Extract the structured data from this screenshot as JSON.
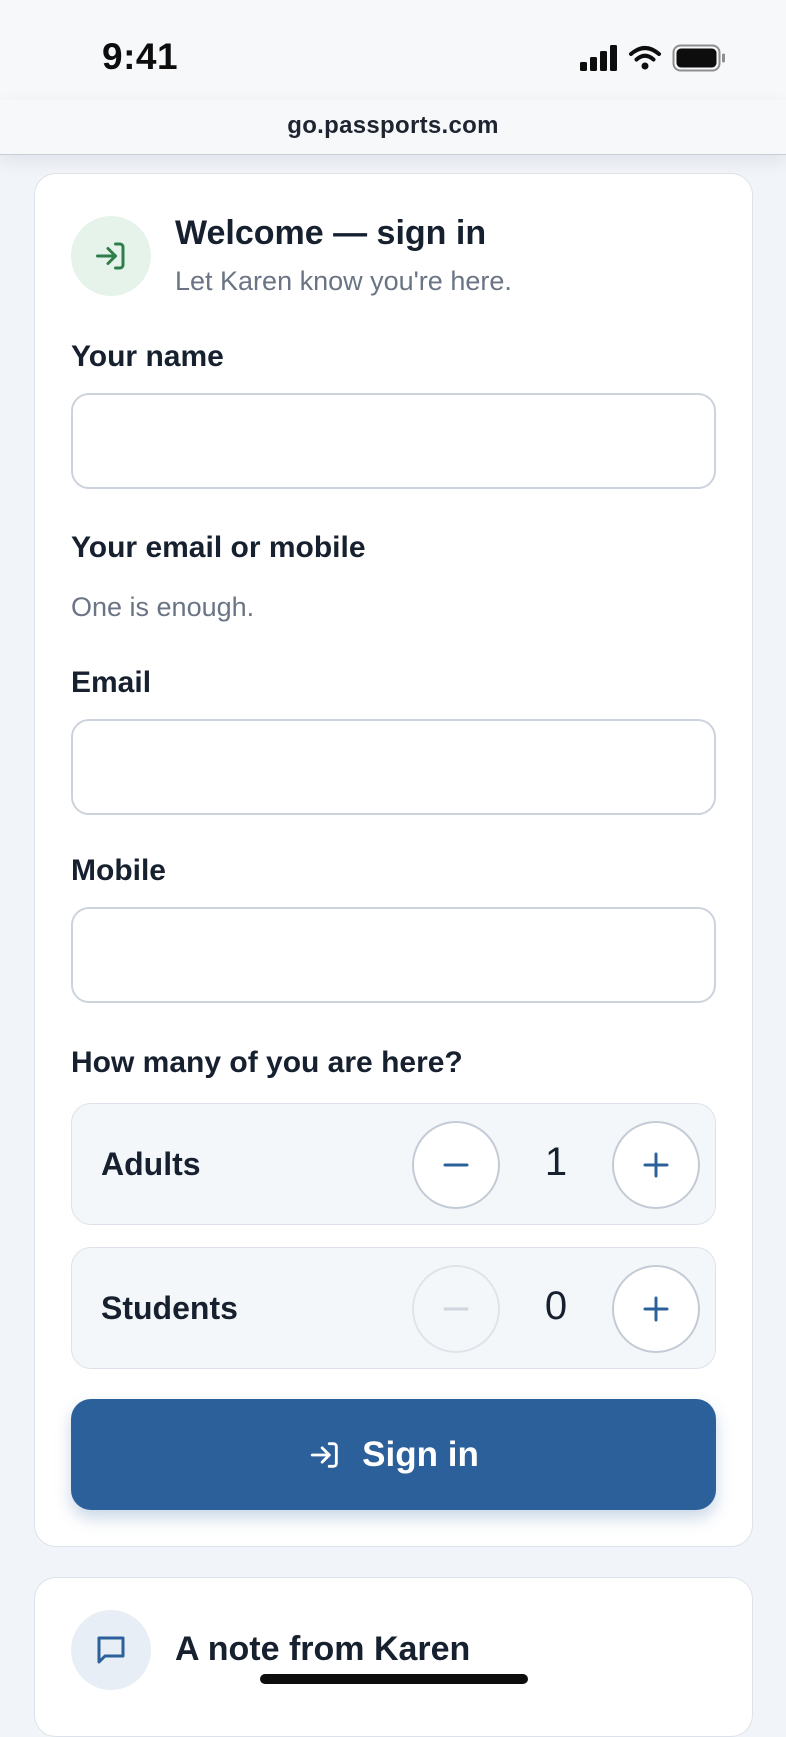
{
  "status_bar": {
    "time": "9:41"
  },
  "browser": {
    "url": "go.passports.com"
  },
  "signin_card": {
    "title": "Welcome — sign in",
    "subtitle": "Let Karen know you're here.",
    "name_label": "Your name",
    "name_value": "",
    "contact_label": "Your email or mobile",
    "contact_hint": "One is enough.",
    "email_label": "Email",
    "email_value": "",
    "mobile_label": "Mobile",
    "mobile_value": "",
    "party_question": "How many of you are here?",
    "counters": [
      {
        "label": "Adults",
        "value": "1",
        "minus_disabled": false
      },
      {
        "label": "Students",
        "value": "0",
        "minus_disabled": true
      }
    ],
    "submit_label": "Sign in"
  },
  "note_card": {
    "title": "A note from Karen"
  },
  "colors": {
    "accent": "#2c609a",
    "signin_icon_bg": "#e6f3ea",
    "signin_icon": "#2e7d4a",
    "note_icon_bg": "#e8eef6"
  },
  "icons": {
    "signin_header": "sign-in-arrow-icon",
    "note_header": "chat-bubble-icon",
    "submit": "sign-in-arrow-icon",
    "status": [
      "signal-icon",
      "wifi-icon",
      "battery-icon"
    ]
  }
}
